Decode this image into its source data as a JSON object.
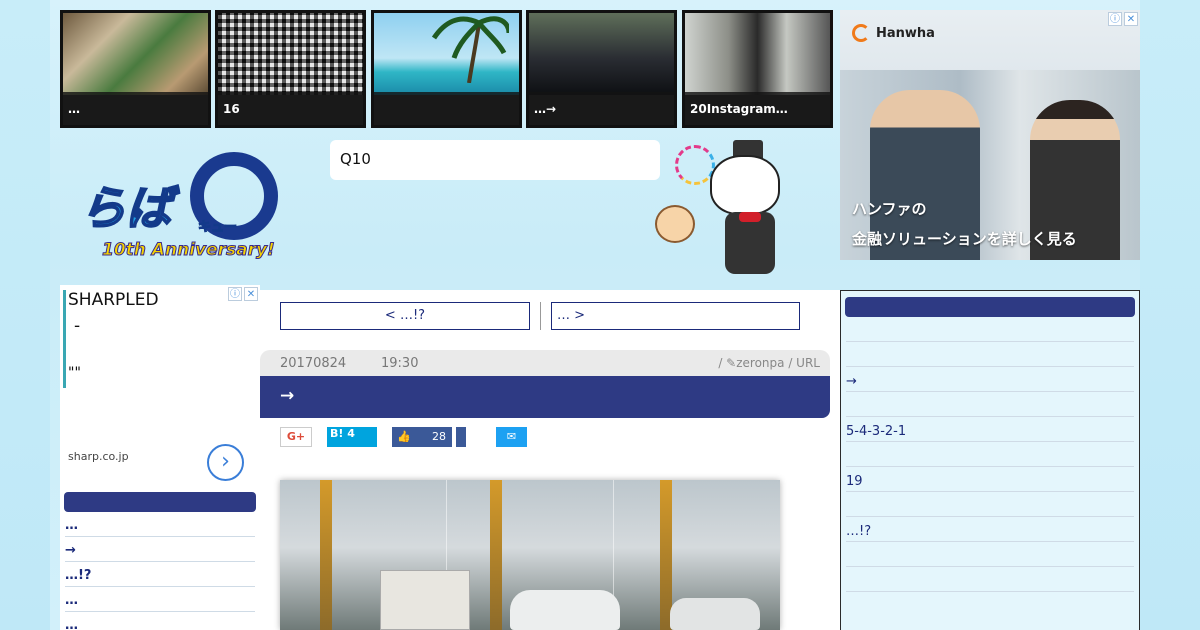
{
  "colors": {
    "nav_dark": "#2e3a84",
    "background": "#cfeffa",
    "link": "#1b2a7a"
  },
  "thumbnails": [
    {
      "caption": "…",
      "icon": "food-photo"
    },
    {
      "caption": "16",
      "icon": "pattern-photo"
    },
    {
      "caption": "",
      "icon": "palm-beach-photo"
    },
    {
      "caption": "…→",
      "icon": "car-photo"
    },
    {
      "caption": "20Instagram…",
      "icon": "fitness-photo"
    }
  ],
  "ad_top": {
    "brand": "Hanwha",
    "line1": "ハンファの",
    "line2": "金融ソリューションを詳しく見る",
    "info_icon": "ⓘ",
    "close_icon": "✕"
  },
  "logo": {
    "main": "らば",
    "kyu": "キュー",
    "anniversary": "10th Anniversary!"
  },
  "search": {
    "value": "Q10"
  },
  "left_ad": {
    "line1": "SHARPLED",
    "line2": " - ",
    "line3": "\"\"",
    "domain": "sharp.co.jp",
    "arrow": "›"
  },
  "left_side": {
    "items": [
      "…",
      "→",
      "…!?",
      "…",
      "…"
    ]
  },
  "post_nav": {
    "prev": "< …!?",
    "next": "… >"
  },
  "post": {
    "date": "20170824",
    "time": "19:30",
    "meta": "/ ✎zeronpa / URL",
    "title": "→"
  },
  "share": {
    "gplus": "G+",
    "hatena": "B! 4",
    "fb_count": "28",
    "tw": "🐦"
  },
  "right_side": {
    "items": [
      "",
      "",
      "→",
      "",
      "5-4-3-2-1",
      "",
      "19",
      "",
      "…!?",
      "",
      ""
    ]
  }
}
